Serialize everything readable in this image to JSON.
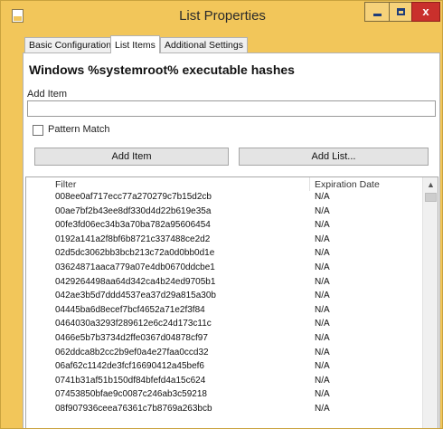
{
  "window": {
    "title": "List Properties",
    "minimize_icon": "minimize-icon",
    "maximize_icon": "maximize-icon",
    "close_label": "x"
  },
  "tabs": [
    {
      "label": "Basic Configuration",
      "active": false
    },
    {
      "label": "List Items",
      "active": true
    },
    {
      "label": "Additional Settings",
      "active": false
    }
  ],
  "panel": {
    "heading": "Windows %systemroot% executable hashes",
    "add_item_label": "Add Item",
    "add_item_value": "",
    "pattern_match_label": "Pattern Match",
    "pattern_match_checked": false,
    "add_item_button": "Add Item",
    "add_list_button": "Add List..."
  },
  "list": {
    "columns": {
      "filter": "Filter",
      "expiration": "Expiration Date"
    },
    "rows": [
      {
        "filter": "008ee0af717ecc77a270279c7b15d2cb",
        "exp": "N/A"
      },
      {
        "filter": "00ae7bf2b43ee8df330d4d22b619e35a",
        "exp": "N/A"
      },
      {
        "filter": "00fe3fd06ec34b3a70ba782a95606454",
        "exp": "N/A"
      },
      {
        "filter": "0192a141a2f8bf6b8721c337488ce2d2",
        "exp": "N/A"
      },
      {
        "filter": "02d5dc3062bb3bcb213c72a0d0bb0d1e",
        "exp": "N/A"
      },
      {
        "filter": "03624871aaca779a07e4db0670ddcbe1",
        "exp": "N/A"
      },
      {
        "filter": "0429264498aa64d342ca4b24ed9705b1",
        "exp": "N/A"
      },
      {
        "filter": "042ae3b5d7ddd4537ea37d29a815a30b",
        "exp": "N/A"
      },
      {
        "filter": "04445ba6d8ecef7bcf4652a71e2f3f84",
        "exp": "N/A"
      },
      {
        "filter": "0464030a3293f289612e6c24d173c11c",
        "exp": "N/A"
      },
      {
        "filter": "0466e5b7b3734d2ffe0367d04878cf97",
        "exp": "N/A"
      },
      {
        "filter": "062ddca8b2cc2b9ef0a4e27faa0ccd32",
        "exp": "N/A"
      },
      {
        "filter": "06af62c1142de3fcf16690412a45bef6",
        "exp": "N/A"
      },
      {
        "filter": "0741b31af51b150df84bfefd4a15c624",
        "exp": "N/A"
      },
      {
        "filter": "07453850bfae9c0087c246ab3c59218",
        "exp": "N/A"
      },
      {
        "filter": "08f907936ceea76361c7b8769a263bcb",
        "exp": "N/A"
      }
    ],
    "scroll_up_icon": "▲"
  }
}
